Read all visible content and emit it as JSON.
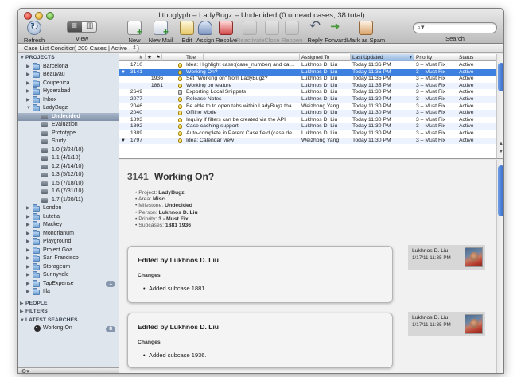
{
  "window": {
    "title": "lithoglyph – LadyBugz – Undecided (0 unread cases, 38 total)"
  },
  "toolbar": {
    "refresh": "Refresh",
    "view": "View",
    "new_case": "New Case",
    "new_mail": "New Mail",
    "edit": "Edit",
    "assign": "Assign",
    "resolve": "Resolve",
    "reactivate": "Reactivate",
    "close": "Close",
    "reopen": "Reopen",
    "reply": "Reply",
    "forward": "Forward",
    "spam": "Mark as Spam",
    "search_label": "Search",
    "search_value": ""
  },
  "condition": {
    "label": "Case List Condition:",
    "value": "200 Cases | Active"
  },
  "sidebar": {
    "projects_header": "PROJECTS",
    "projects": [
      {
        "label": "Barcelona"
      },
      {
        "label": "Beauvau"
      },
      {
        "label": "Coupenica"
      },
      {
        "label": "Hyderabad"
      },
      {
        "label": "Inbox"
      },
      {
        "label": "LadyBugz"
      }
    ],
    "ladybugz_children": [
      {
        "label": "Undecided",
        "selected": true
      },
      {
        "label": "Evaluation"
      },
      {
        "label": "Prototype"
      },
      {
        "label": "Study"
      },
      {
        "label": "1.0 (3/24/10)"
      },
      {
        "label": "1.1 (4/1/10)"
      },
      {
        "label": "1.2 (4/14/10)"
      },
      {
        "label": "1.3 (5/12/10)"
      },
      {
        "label": "1.5 (7/18/10)"
      },
      {
        "label": "1.6 (7/31/10)"
      },
      {
        "label": "1.7 (1/20/11)"
      }
    ],
    "more_projects": [
      {
        "label": "London"
      },
      {
        "label": "Lutetia"
      },
      {
        "label": "Mackey"
      },
      {
        "label": "Mondrianum"
      },
      {
        "label": "Playground"
      },
      {
        "label": "Project Goa"
      },
      {
        "label": "San Francisco"
      },
      {
        "label": "Storageum"
      },
      {
        "label": "Sunnyvale"
      },
      {
        "label": "TapExpense",
        "badge": "1"
      },
      {
        "label": "Illa"
      }
    ],
    "people_header": "PEOPLE",
    "filters_header": "FILTERS",
    "latest_header": "LATEST SEARCHES",
    "latest": [
      {
        "label": "Working On",
        "badge": "8"
      }
    ]
  },
  "list": {
    "columns": {
      "num": "#",
      "star": "★",
      "flag": "⚑",
      "title": "Title",
      "assigned": "Assigned To",
      "updated": "Last Updated",
      "priority": "Priority",
      "status": "Status"
    },
    "rows": [
      {
        "num": "1710",
        "title": "Idea: Highlight case:(case_number) and ca…",
        "assigned": "Lukhnos D. Liu",
        "updated": "Today 11:36 PM",
        "priority": "3 – Must Fix",
        "status": "Active"
      },
      {
        "num": "3141",
        "title": "Working On?",
        "assigned": "Lukhnos D. Liu",
        "updated": "Today 11:35 PM",
        "priority": "3 – Must Fix",
        "status": "Active"
      },
      {
        "num": "1936",
        "title": "Set \"Working on\" from LadyBugz?",
        "assigned": "Lukhnos D. Liu",
        "updated": "Today 11:35 PM",
        "priority": "3 – Must Fix",
        "status": "Active"
      },
      {
        "num": "1881",
        "title": "Working on feature",
        "assigned": "Lukhnos D. Liu",
        "updated": "Today 11:35 PM",
        "priority": "3 – Must Fix",
        "status": "Active"
      },
      {
        "num": "2649",
        "title": "Exporting Local Snippets",
        "assigned": "Lukhnos D. Liu",
        "updated": "Today 11:30 PM",
        "priority": "3 – Must Fix",
        "status": "Active"
      },
      {
        "num": "2077",
        "title": "Release Notes",
        "assigned": "Lukhnos D. Liu",
        "updated": "Today 11:30 PM",
        "priority": "3 – Must Fix",
        "status": "Active"
      },
      {
        "num": "2046",
        "title": "Be able to to open tabs within LadyBugz tha…",
        "assigned": "Weizhong Yang",
        "updated": "Today 11:30 PM",
        "priority": "3 – Must Fix",
        "status": "Active"
      },
      {
        "num": "2040",
        "title": "Offline Mode",
        "assigned": "Lukhnos D. Liu",
        "updated": "Today 11:30 PM",
        "priority": "3 – Must Fix",
        "status": "Active"
      },
      {
        "num": "1893",
        "title": "Inquiry if filters can be created via the API",
        "assigned": "Lukhnos D. Liu",
        "updated": "Today 11:30 PM",
        "priority": "3 – Must Fix",
        "status": "Active"
      },
      {
        "num": "1892",
        "title": "Case caching support",
        "assigned": "Lukhnos D. Liu",
        "updated": "Today 11:30 PM",
        "priority": "3 – Must Fix",
        "status": "Active"
      },
      {
        "num": "1889",
        "title": "Auto-complete in Parent Case field (case de…",
        "assigned": "Lukhnos D. Liu",
        "updated": "Today 11:30 PM",
        "priority": "3 – Must Fix",
        "status": "Active"
      },
      {
        "num": "1797",
        "title": "Idea: Calendar view",
        "assigned": "Weizhong Yang",
        "updated": "Today 11:30 PM",
        "priority": "3 – Must Fix",
        "status": "Active"
      }
    ]
  },
  "detail": {
    "num": "3141",
    "title": "Working On?",
    "meta": [
      {
        "label": "Project:",
        "value": "LadyBugz"
      },
      {
        "label": "Area:",
        "value": "Misc"
      },
      {
        "label": "Milestone:",
        "value": "Undecided"
      },
      {
        "label": "Person:",
        "value": "Lukhnos D. Liu"
      },
      {
        "label": "Priority:",
        "value": "3 - Must Fix"
      },
      {
        "label": "Subcases:",
        "value": "1881 1936"
      }
    ],
    "events": [
      {
        "title": "Edited by Lukhnos D. Liu",
        "changes": "Changes",
        "item": "Added subcase 1881.",
        "who": "Lukhnos D. Liu",
        "when": "1/17/11 11:35 PM"
      },
      {
        "title": "Edited by Lukhnos D. Liu",
        "changes": "Changes",
        "item": "Added subcase 1936.",
        "who": "Lukhnos D. Liu",
        "when": "1/17/11 11:35 PM"
      }
    ]
  },
  "colors": {
    "selection": "#3d80df",
    "sidebar_bg": "#dfe5ed",
    "sidebar_selected": "#8192a9"
  }
}
